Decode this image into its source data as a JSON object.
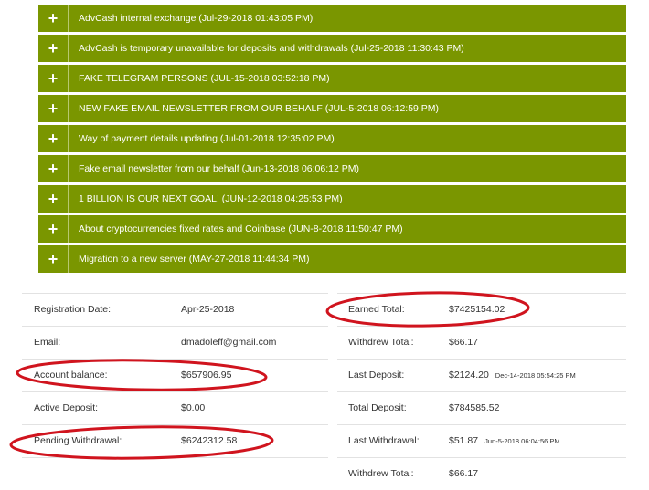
{
  "news": [
    {
      "title": "AdvCash internal exchange (Jul-29-2018 01:43:05 PM)"
    },
    {
      "title": "AdvCash is temporary unavailable for deposits and withdrawals (Jul-25-2018 11:30:43 PM)"
    },
    {
      "title": "FAKE TELEGRAM PERSONS (JUL-15-2018 03:52:18 PM)"
    },
    {
      "title": "NEW FAKE EMAIL NEWSLETTER FROM OUR BEHALF (JUL-5-2018 06:12:59 PM)"
    },
    {
      "title": "Way of payment details updating (Jul-01-2018 12:35:02 PM)"
    },
    {
      "title": "Fake email newsletter from our behalf (Jun-13-2018 06:06:12 PM)"
    },
    {
      "title": "1 BILLION IS OUR NEXT GOAL! (JUN-12-2018 04:25:53 PM)"
    },
    {
      "title": "About cryptocurrencies fixed rates and Coinbase (JUN-8-2018 11:50:47 PM)"
    },
    {
      "title": "Migration to a new server (MAY-27-2018 11:44:34 PM)"
    }
  ],
  "news_icon": "+",
  "account": {
    "left": [
      {
        "label": "Registration Date:",
        "value": "Apr-25-2018"
      },
      {
        "label": "Email:",
        "value": "dmadoleff@gmail.com"
      },
      {
        "label": "Account balance:",
        "value": "$657906.95"
      },
      {
        "label": "Active Deposit:",
        "value": "$0.00"
      },
      {
        "label": "Pending Withdrawal:",
        "value": "$6242312.58"
      }
    ],
    "right": [
      {
        "label": "Earned Total:",
        "value": "$7425154.02",
        "extra": ""
      },
      {
        "label": "Withdrew Total:",
        "value": "$66.17",
        "extra": ""
      },
      {
        "label": "Last Deposit:",
        "value": "$2124.20",
        "extra": "Dec-14-2018 05:54:25 PM"
      },
      {
        "label": "Total Deposit:",
        "value": "$784585.52",
        "extra": ""
      },
      {
        "label": "Last Withdrawal:",
        "value": "$51.87",
        "extra": "Jun-5-2018 06:04:56 PM"
      },
      {
        "label": "Withdrew Total:",
        "value": "$66.17",
        "extra": ""
      }
    ]
  },
  "colors": {
    "news_bg": "#7a9600",
    "highlight_ring": "#d0141e"
  }
}
